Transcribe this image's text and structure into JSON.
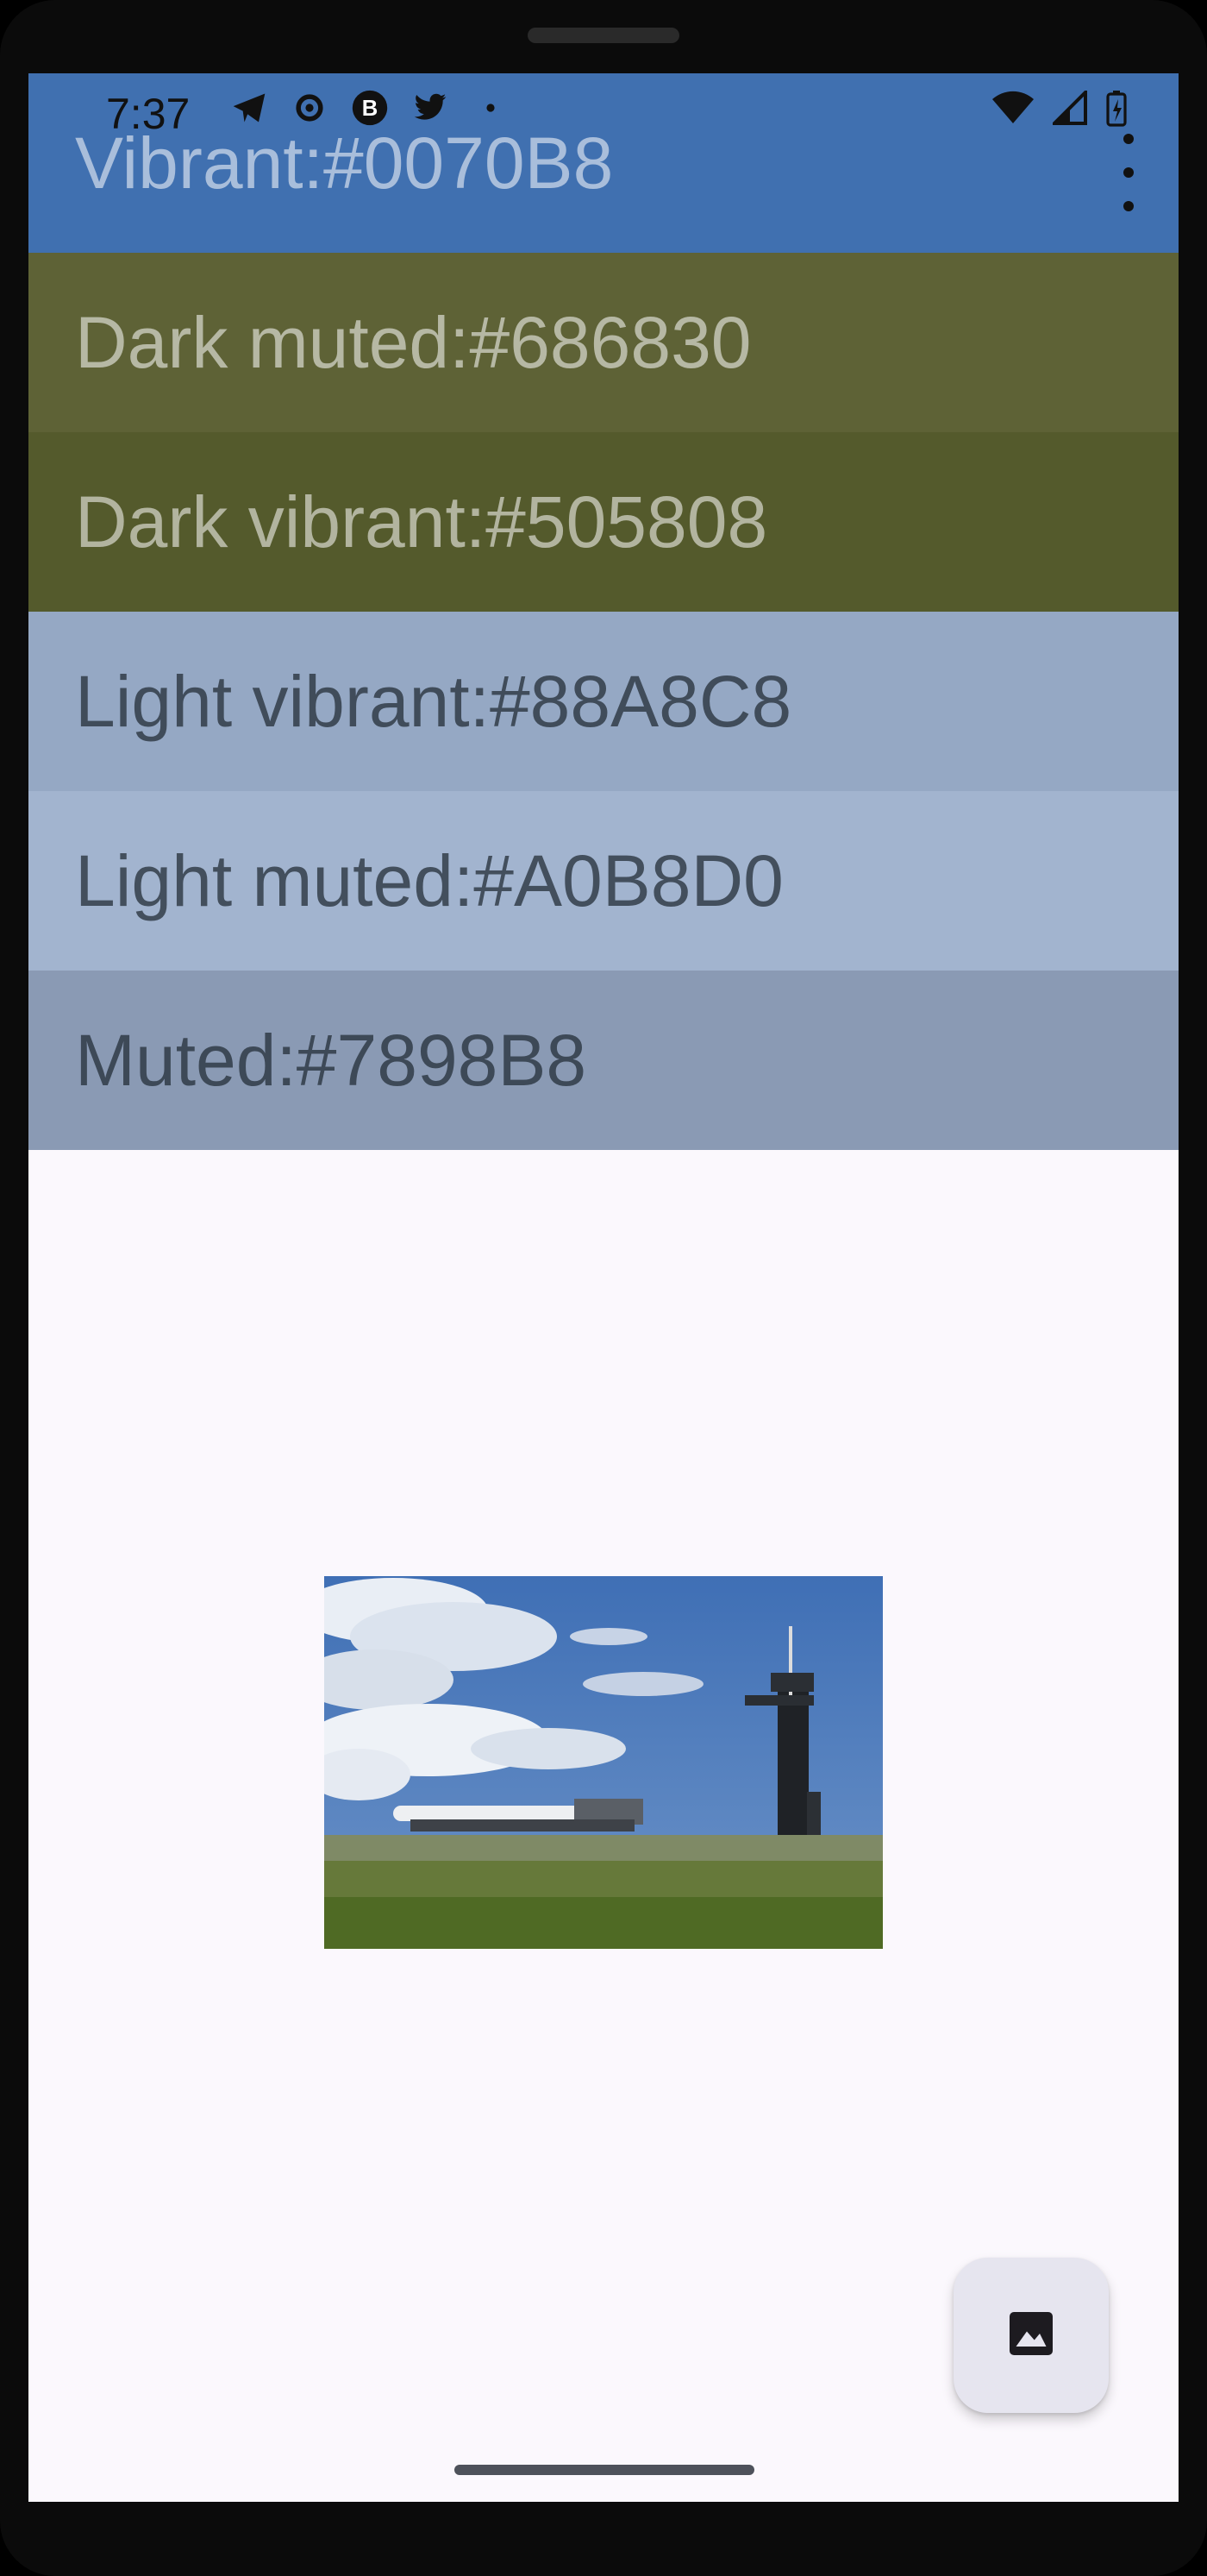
{
  "status_bar": {
    "time": "7:37",
    "icons": [
      "telegram-icon",
      "settings-gear-icon",
      "b-circle-icon",
      "twitter-icon",
      "dot-icon"
    ],
    "right_icons": [
      "wifi-icon",
      "signal-icon",
      "battery-charging-icon"
    ]
  },
  "swatches": [
    {
      "label": "Vibrant:#0070B8",
      "color": "#4070B0"
    },
    {
      "label": "Dark muted:#686830",
      "color": "#5E6236"
    },
    {
      "label": "Dark vibrant:#505808",
      "color": "#545A2C"
    },
    {
      "label": "Light vibrant:#88A8C8",
      "color": "#95A8C4"
    },
    {
      "label": "Light muted:#A0B8D0",
      "color": "#A2B4CF"
    },
    {
      "label": "Muted:#7898B8",
      "color": "#8A9AB4"
    }
  ],
  "toolbar": {
    "overflow_icon": "more-vert-icon"
  },
  "image": {
    "subject": "rocket launch pad photo"
  },
  "fab": {
    "icon": "image-icon"
  }
}
